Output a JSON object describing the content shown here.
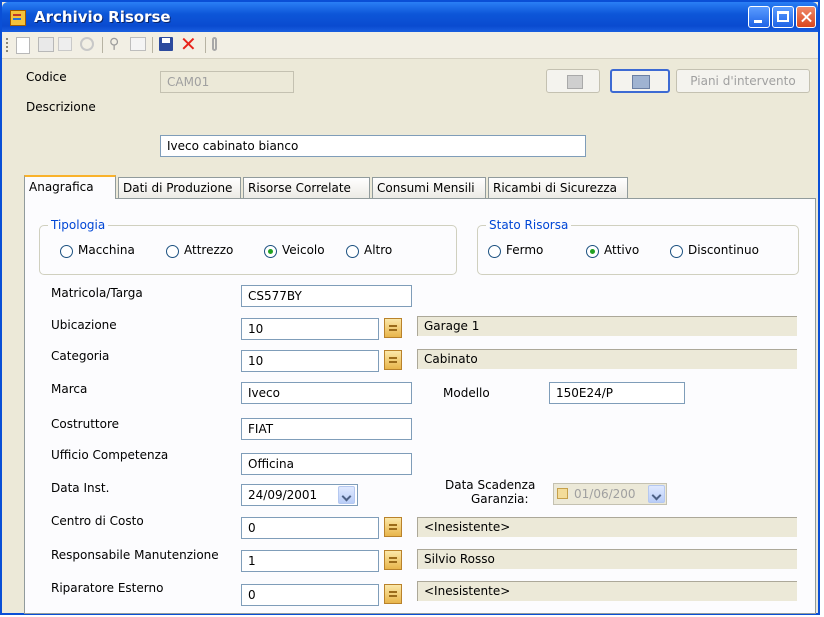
{
  "window": {
    "title": "Archivio Risorse"
  },
  "header": {
    "codice_label": "Codice",
    "codice_value": "CAM01",
    "descrizione_label": "Descrizione",
    "descrizione_value": "Iveco cabinato bianco",
    "piani_button": "Piani d'intervento"
  },
  "tabs": [
    "Anagrafica",
    "Dati di Produzione",
    "Risorse Correlate",
    "Consumi Mensili",
    "Ricambi di Sicurezza"
  ],
  "tipologia": {
    "title": "Tipologia",
    "options": [
      "Macchina",
      "Attrezzo",
      "Veicolo",
      "Altro"
    ],
    "selected": "Veicolo"
  },
  "stato": {
    "title": "Stato Risorsa",
    "options": [
      "Fermo",
      "Attivo",
      "Discontinuo"
    ],
    "selected": "Attivo"
  },
  "form": {
    "matricola": {
      "label": "Matricola/Targa",
      "value": "CS577BY"
    },
    "ubicazione": {
      "label": "Ubicazione",
      "value": "10",
      "desc": "Garage 1"
    },
    "categoria": {
      "label": "Categoria",
      "value": "10",
      "desc": "Cabinato"
    },
    "marca": {
      "label": "Marca",
      "value": "Iveco"
    },
    "modello": {
      "label": "Modello",
      "value": "150E24/P"
    },
    "costruttore": {
      "label": "Costruttore",
      "value": "FIAT"
    },
    "ufficio": {
      "label": "Ufficio Competenza",
      "value": "Officina"
    },
    "data_inst": {
      "label": "Data Inst.",
      "value": "24/09/2001"
    },
    "data_scadenza": {
      "label_line1": "Data Scadenza",
      "label_line2": "Garanzia:",
      "value": "01/06/200"
    },
    "centro_costo": {
      "label": "Centro di Costo",
      "value": "0",
      "desc": "<Inesistente>"
    },
    "responsabile": {
      "label": "Responsabile Manutenzione",
      "value": "1",
      "desc": "Silvio Rosso"
    },
    "riparatore": {
      "label": "Riparatore Esterno",
      "value": "0",
      "desc": "<Inesistente>"
    }
  }
}
